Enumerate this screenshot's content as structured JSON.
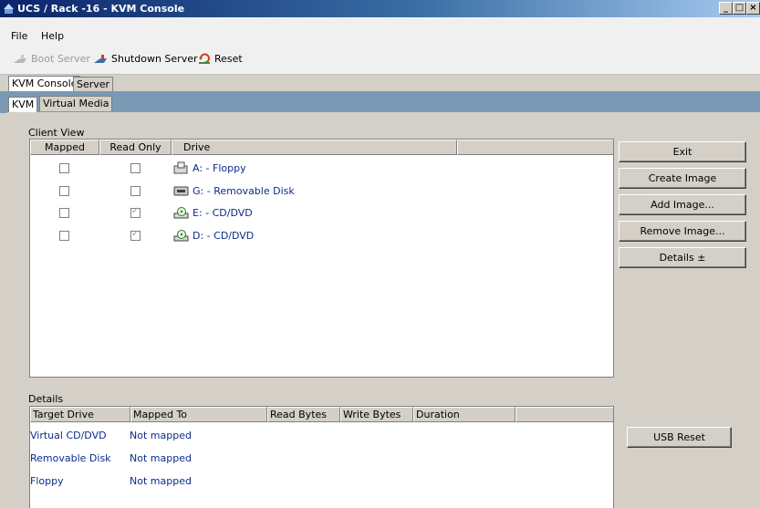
{
  "window": {
    "title": "UCS / Rack -16 - KVM Console",
    "controls": {
      "minimize": "_",
      "maximize": "□",
      "close": "×"
    }
  },
  "menu": {
    "items": [
      "File",
      "Help"
    ]
  },
  "toolbar": {
    "boot_label": "Boot Server",
    "shutdown_label": "Shutdown Server",
    "reset_label": "Reset"
  },
  "tabs_main": [
    "KVM Console",
    "Server"
  ],
  "tabs_sub": [
    "KVM",
    "Virtual Media"
  ],
  "client_view": {
    "label": "Client View",
    "columns": [
      "Mapped",
      "Read Only",
      "Drive"
    ],
    "rows": [
      {
        "mapped": false,
        "read_only": false,
        "drive": "A: - Floppy",
        "icon": "floppy-drive-icon"
      },
      {
        "mapped": false,
        "read_only": false,
        "drive": "G: - Removable Disk",
        "icon": "removable-disk-icon"
      },
      {
        "mapped": false,
        "read_only": true,
        "drive": "E: - CD/DVD",
        "icon": "cd-dvd-drive-icon"
      },
      {
        "mapped": false,
        "read_only": true,
        "drive": "D: - CD/DVD",
        "icon": "cd-dvd-drive-icon"
      }
    ]
  },
  "side_buttons": {
    "exit": "Exit",
    "create_image": "Create Image",
    "add_image": "Add Image...",
    "remove_image": "Remove Image...",
    "details": "Details ±",
    "usb_reset": "USB Reset"
  },
  "details": {
    "label": "Details",
    "columns": [
      "Target Drive",
      "Mapped To",
      "Read Bytes",
      "Write Bytes",
      "Duration"
    ],
    "rows": [
      {
        "target": "Virtual CD/DVD",
        "mapped_to": "Not mapped"
      },
      {
        "target": "Removable Disk",
        "mapped_to": "Not mapped"
      },
      {
        "target": "Floppy",
        "mapped_to": "Not mapped"
      }
    ]
  },
  "colors": {
    "title_bar": "#0a246a",
    "link_text": "#0a2c8c",
    "tab_strip": "#7a99b4"
  }
}
